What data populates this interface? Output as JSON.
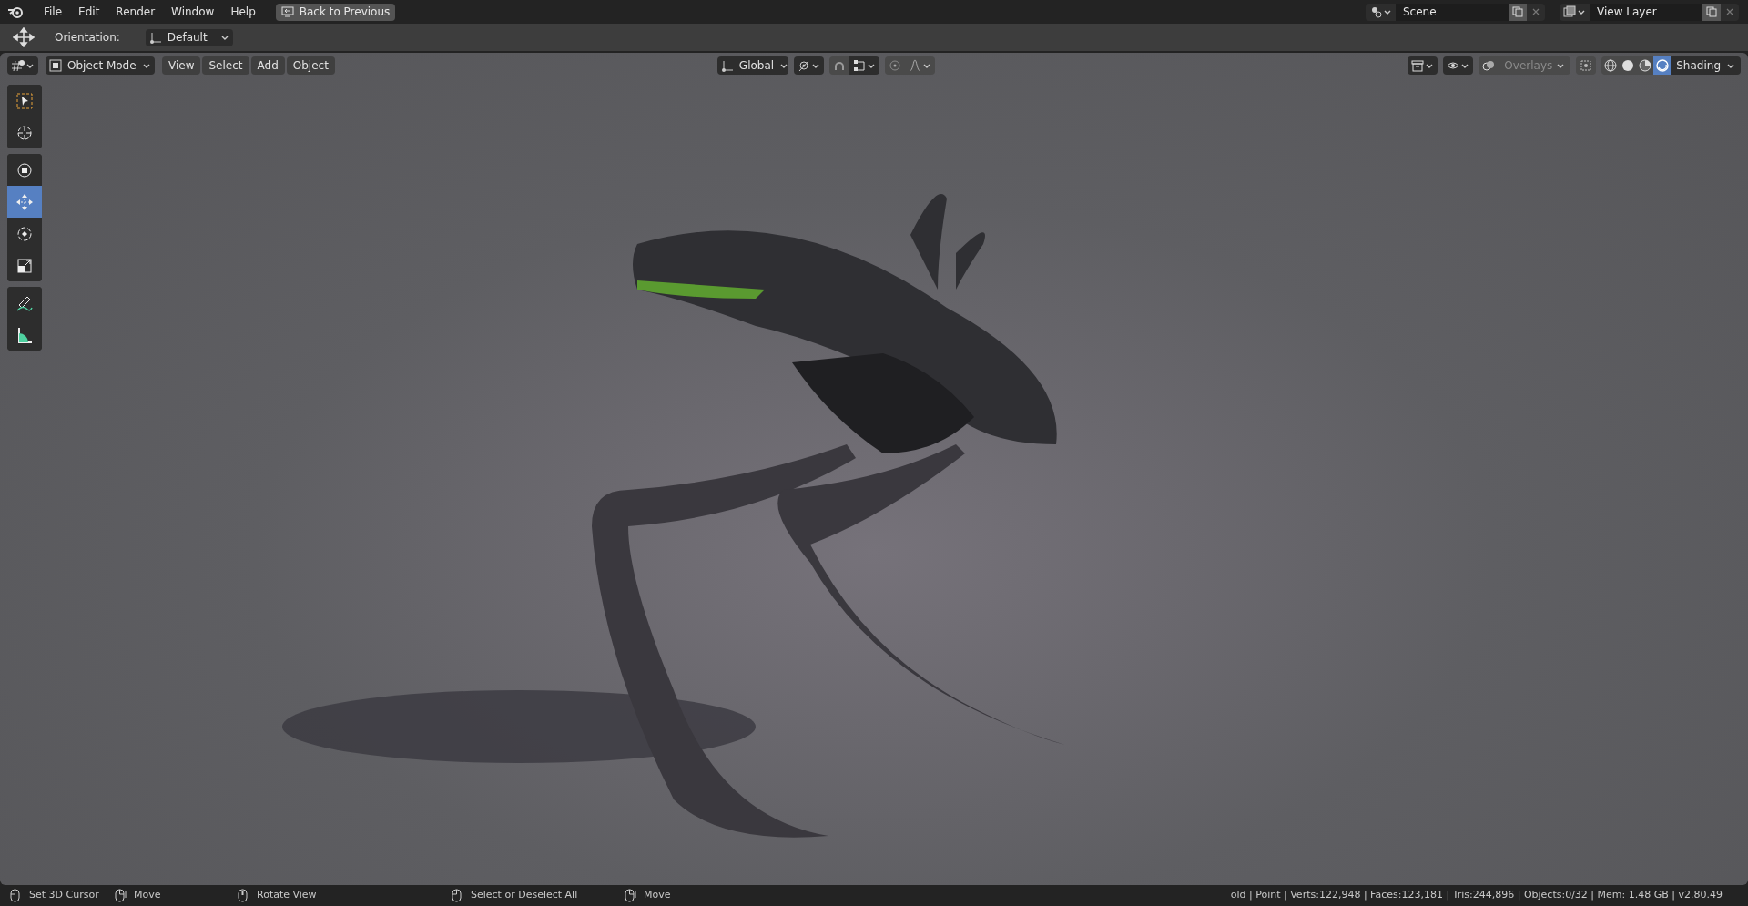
{
  "top_bar": {
    "menus": [
      "File",
      "Edit",
      "Render",
      "Window",
      "Help"
    ],
    "back_button": "Back to Previous",
    "scene": "Scene",
    "view_layer": "View Layer"
  },
  "tool_settings": {
    "orientation_label": "Orientation:",
    "orientation_value": "Default"
  },
  "viewport_header": {
    "mode": "Object Mode",
    "menus": [
      "View",
      "Select",
      "Add",
      "Object"
    ],
    "transform_orientation": "Global",
    "overlays": "Overlays",
    "shading": "Shading",
    "shading_modes": [
      {
        "kind": "wireframe",
        "selected": false
      },
      {
        "kind": "solid",
        "selected": false
      },
      {
        "kind": "material",
        "selected": false
      },
      {
        "kind": "rendered",
        "selected": true
      }
    ]
  },
  "toolbar": [
    {
      "tools": [
        {
          "kind": "select",
          "selected": false
        },
        {
          "kind": "cursor",
          "selected": false
        }
      ]
    },
    {
      "tools": [
        {
          "kind": "transform",
          "selected": false
        },
        {
          "kind": "move",
          "selected": true
        },
        {
          "kind": "rotate",
          "selected": false
        },
        {
          "kind": "scale",
          "selected": false
        }
      ]
    },
    {
      "tools": [
        {
          "kind": "annotate",
          "selected": false
        },
        {
          "kind": "measure",
          "selected": false
        }
      ]
    }
  ],
  "status_bar": {
    "hints": [
      {
        "kind": "click",
        "text": "Set 3D Cursor"
      },
      {
        "kind": "drag",
        "text": "Move"
      },
      {
        "kind": "middle",
        "text": "Rotate View"
      },
      {
        "kind": "click",
        "text": "Select or Deselect All"
      },
      {
        "kind": "drag",
        "text": "Move"
      }
    ],
    "stats": "old | Point | Verts:122,948 | Faces:123,181 | Tris:244,896 | Objects:0/32 | Mem: 1.48 GB | v2.80.49"
  }
}
